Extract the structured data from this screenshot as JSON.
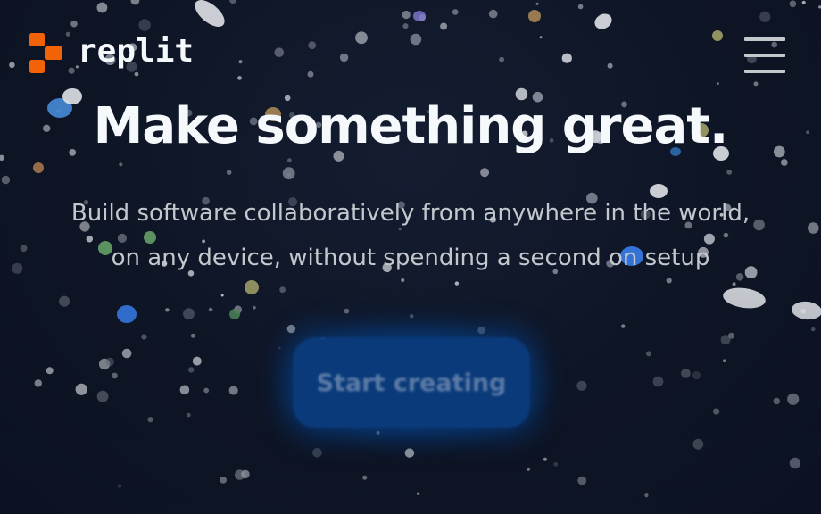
{
  "brand": {
    "name": "replit",
    "colors": {
      "logo_orange": "#f26207",
      "background": "#0e1525",
      "title_text": "#f5f9fc",
      "subtitle_text": "#c2c8cc",
      "cta_blue": "#0a3a7a"
    }
  },
  "header": {
    "logo_icon": "replit-logo-icon",
    "menu_icon": "hamburger-menu-icon"
  },
  "hero": {
    "title": "Make something great.",
    "subtitle_line1": "Build software collaboratively from anywhere in the world,",
    "subtitle_line2": "on any device, without spending a second on setup",
    "cta_label": "Start creating"
  }
}
